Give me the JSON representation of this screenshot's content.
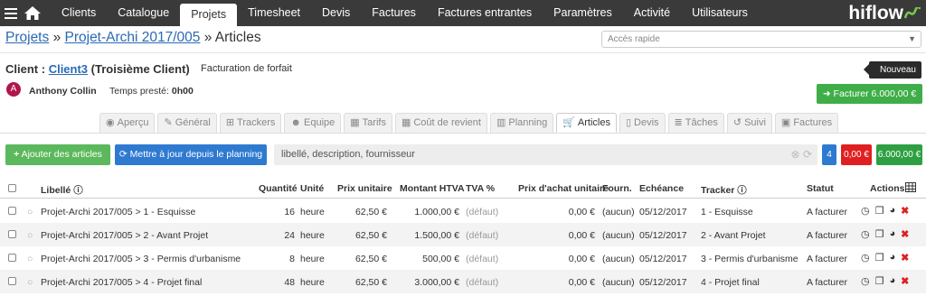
{
  "nav": {
    "items": [
      "Clients",
      "Catalogue",
      "Projets",
      "Timesheet",
      "Devis",
      "Factures",
      "Factures entrantes",
      "Paramètres",
      "Activité",
      "Utilisateurs"
    ],
    "active": "Projets",
    "brand": "hiflow"
  },
  "breadcrumb": {
    "projets": "Projets",
    "project": "Projet-Archi 2017/005",
    "current": "» Articles",
    "sep": "»"
  },
  "quick_access": {
    "placeholder": "Accès rapide"
  },
  "client": {
    "label": "Client :",
    "link": "Client3",
    "suffix": "(Troisième Client)",
    "billing": "Facturation de forfait",
    "avatar_letter": "A",
    "person": "Anthony Collin",
    "time_label": "Temps presté:",
    "time_value": "0h00"
  },
  "buttons": {
    "nouveau": "Nouveau",
    "facturer": "Facturer 6.000,00 €",
    "add": "Ajouter des articles",
    "update": "Mettre à jour depuis le planning"
  },
  "tabs": [
    "Aperçu",
    "Général",
    "Trackers",
    "Equipe",
    "Tarifs",
    "Coût de revient",
    "Planning",
    "Articles",
    "Devis",
    "Tâches",
    "Suivi",
    "Factures"
  ],
  "active_tab": "Articles",
  "filter": {
    "placeholder": "libellé, description, fournisseur"
  },
  "summary": {
    "count": "4",
    "red": "0,00 €",
    "green": "6.000,00 €"
  },
  "table": {
    "headers": [
      "Libellé",
      "Quantité",
      "Unité",
      "Prix unitaire",
      "Montant HTVA",
      "TVA %",
      "Prix d'achat unitaire",
      "Fourn.",
      "Echéance",
      "Tracker",
      "Statut",
      "Actions"
    ],
    "rows": [
      [
        "Projet-Archi 2017/005 > 1 - Esquisse",
        "16",
        "heure",
        "62,50 €",
        "1.000,00 €",
        "(défaut)",
        "0,00 €",
        "(aucun)",
        "05/12/2017",
        "1 - Esquisse",
        "A facturer"
      ],
      [
        "Projet-Archi 2017/005 > 2 - Avant Projet",
        "24",
        "heure",
        "62,50 €",
        "1.500,00 €",
        "(défaut)",
        "0,00 €",
        "(aucun)",
        "05/12/2017",
        "2 - Avant Projet",
        "A facturer"
      ],
      [
        "Projet-Archi 2017/005 > 3 - Permis d'urbanisme",
        "8",
        "heure",
        "62,50 €",
        "500,00 €",
        "(défaut)",
        "0,00 €",
        "(aucun)",
        "05/12/2017",
        "3 - Permis d'urbanisme",
        "A facturer"
      ],
      [
        "Projet-Archi 2017/005 > 4 - Projet final",
        "48",
        "heure",
        "62,50 €",
        "3.000,00 €",
        "(défaut)",
        "0,00 €",
        "(aucun)",
        "05/12/2017",
        "4 - Projet final",
        "A facturer"
      ]
    ]
  },
  "colors": {
    "nav_bg": "#3a3a3a",
    "link": "#2a6ab5",
    "green": "#3fae49",
    "blue": "#2f7ad1",
    "red": "#e02020"
  }
}
